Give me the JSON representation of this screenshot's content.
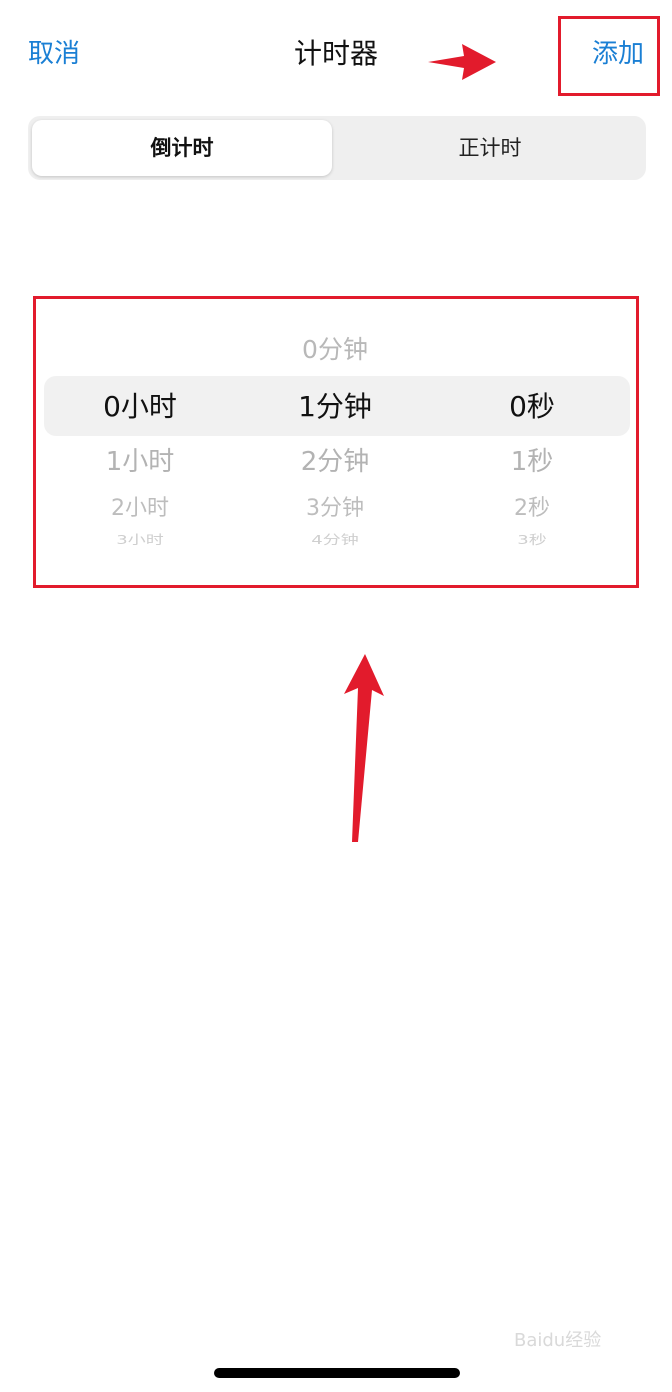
{
  "nav": {
    "cancel_label": "取消",
    "title": "计时器",
    "add_label": "添加"
  },
  "segmented": {
    "active_label": "倒计时",
    "inactive_label": "正计时"
  },
  "picker": {
    "hours": {
      "selected": "0小时",
      "plus1": "1小时",
      "plus2": "2小时",
      "plus3": "3小时"
    },
    "minutes": {
      "minus1": "0分钟",
      "selected": "1分钟",
      "plus1": "2分钟",
      "plus2": "3分钟",
      "plus3": "4分钟"
    },
    "seconds": {
      "selected": "0秒",
      "plus1": "1秒",
      "plus2": "2秒",
      "plus3": "3秒"
    }
  },
  "annotations": {
    "color": "#e21b2c"
  },
  "watermark": "Baidu经验"
}
